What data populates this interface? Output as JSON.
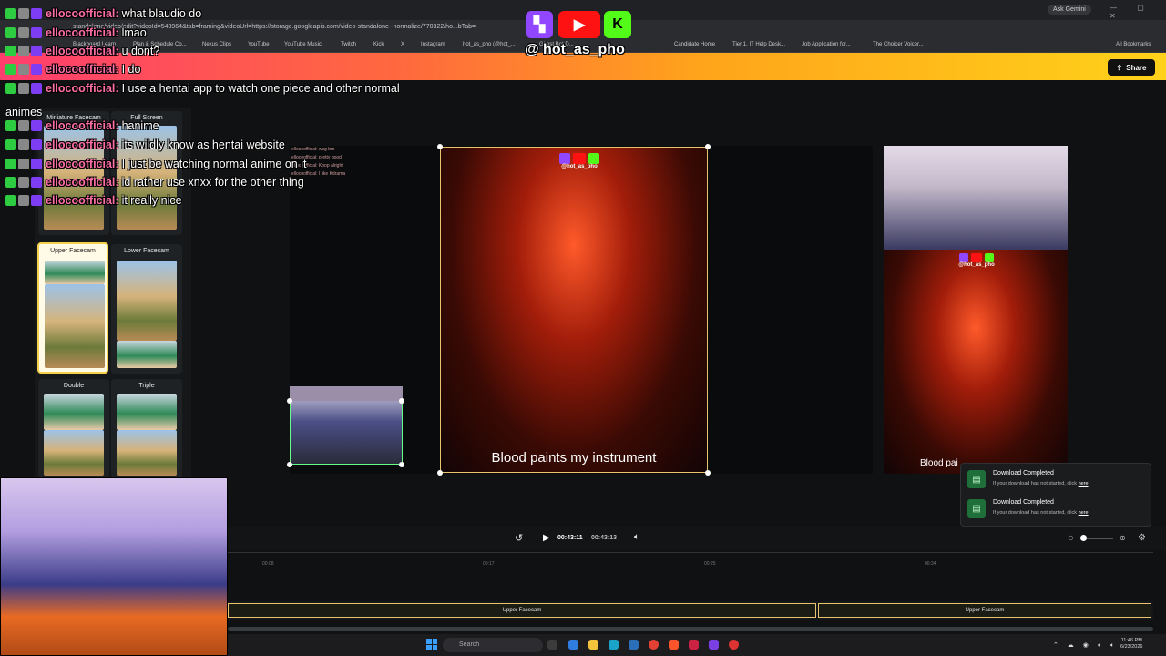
{
  "browser": {
    "url": "standalone/video/edit?videoId=543964&tab=framing&videoUrl=https://storage.googleapis.com/video-standalone--normalize/770322/ho...bTab=",
    "ask_gemini": "Ask Gemini",
    "window_controls": "—  ▢  ✕",
    "bookmarks": [
      "Blackboard Learn",
      "Plan & Schedule Co...",
      "Nexus Clips",
      "YouTube",
      "YouTube Music",
      "Twitch",
      "Kick",
      "X",
      "Instagram",
      "hot_as_pho (@hot_...",
      "Ghost Bot D...",
      "Candidate Home",
      "Tier 1, IT Help Desk...",
      "Job Application for...",
      "The Choicer Voicer..."
    ],
    "all_bookmarks": "All Bookmarks"
  },
  "header": {
    "share_label": "Share"
  },
  "layouts": [
    {
      "label": "Miniature Facecam"
    },
    {
      "label": "Full Screen"
    },
    {
      "label": "Upper Facecam"
    },
    {
      "label": "Lower Facecam"
    },
    {
      "label": "Double"
    },
    {
      "label": "Triple"
    }
  ],
  "preview": {
    "caption": "Blood paints my instrument",
    "right_caption": "Blood pai",
    "handle": "@hot_as_pho",
    "mini_chat": [
      "ellocoofficial: wsg bro",
      "ellocoofficial: pretty good",
      "ellocoofficial: Kpop alright",
      "ellocoofficial: I like Kdrama"
    ]
  },
  "toasts": [
    {
      "title": "Download Completed",
      "sub": "If your download has not started, click",
      "link": "here"
    },
    {
      "title": "Download Completed",
      "sub": "If your download has not started, click",
      "link": "here"
    }
  ],
  "player": {
    "current": "00:43:11",
    "total": "00:43:13"
  },
  "timeline": {
    "ticks": [
      "00:08",
      "00:17",
      "00:25",
      "00:34"
    ],
    "clips": [
      "Upper Facecam",
      "Upper Facecam"
    ]
  },
  "taskbar": {
    "search": "Search",
    "time": "11:46 PM",
    "date": "6/23/2026"
  },
  "chat": [
    {
      "user": "ellocoofficial:",
      "msg": "what blaudio do"
    },
    {
      "user": "ellocoofficial:",
      "msg": "lmao"
    },
    {
      "user": "ellocoofficial:",
      "msg": "u dont?"
    },
    {
      "user": "ellocoofficial:",
      "msg": "I do"
    },
    {
      "user": "ellocoofficial:",
      "msg": "I use a hentai app to watch one piece and other normal"
    },
    {
      "user": "ellocoofficial:",
      "msg": "hanime"
    },
    {
      "user": "ellocoofficial:",
      "msg": "its wildly know as hentai website"
    },
    {
      "user": "ellocoofficial:",
      "msg": "I just be watching normal anime on it"
    },
    {
      "user": "ellocoofficial:",
      "msg": "id rather use xnxx for the other thing"
    },
    {
      "user": "ellocoofficial:",
      "msg": "it really nice"
    }
  ],
  "chat_wrap": "animes",
  "social": {
    "handle": "@ hot_as_pho"
  }
}
